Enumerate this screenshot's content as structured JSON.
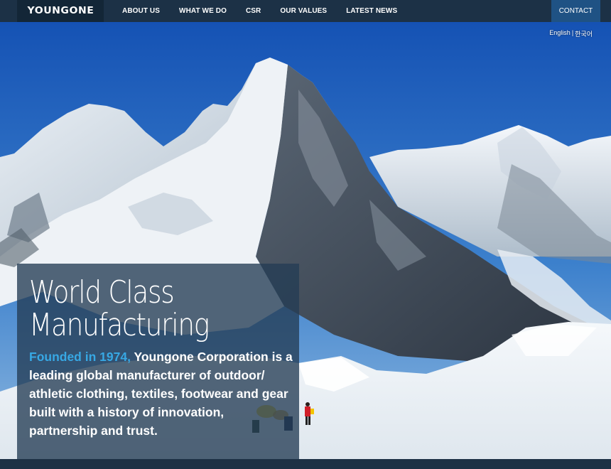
{
  "brand": {
    "logo_text": "YOUNGONE"
  },
  "nav": {
    "items": [
      {
        "label": "ABOUT US"
      },
      {
        "label": "WHAT WE DO"
      },
      {
        "label": "CSR"
      },
      {
        "label": "OUR VALUES"
      },
      {
        "label": "LATEST NEWS"
      }
    ],
    "contact_label": "CONTACT"
  },
  "language": {
    "english": "English",
    "separator": "|",
    "korean": "한국어"
  },
  "hero": {
    "headline_line1": "World Class",
    "headline_line2": "Manufacturing",
    "highlight": "Founded in 1974,",
    "body": " Youngone Corporation is a leading global manufacturer of outdoor/ athletic clothing, textiles, footwear and gear built with a history of innovation, partnership and trust."
  },
  "colors": {
    "navbar": "#1c3146",
    "contact_button": "#1f5284",
    "highlight": "#37a8e4",
    "overlay": "#243c54"
  }
}
